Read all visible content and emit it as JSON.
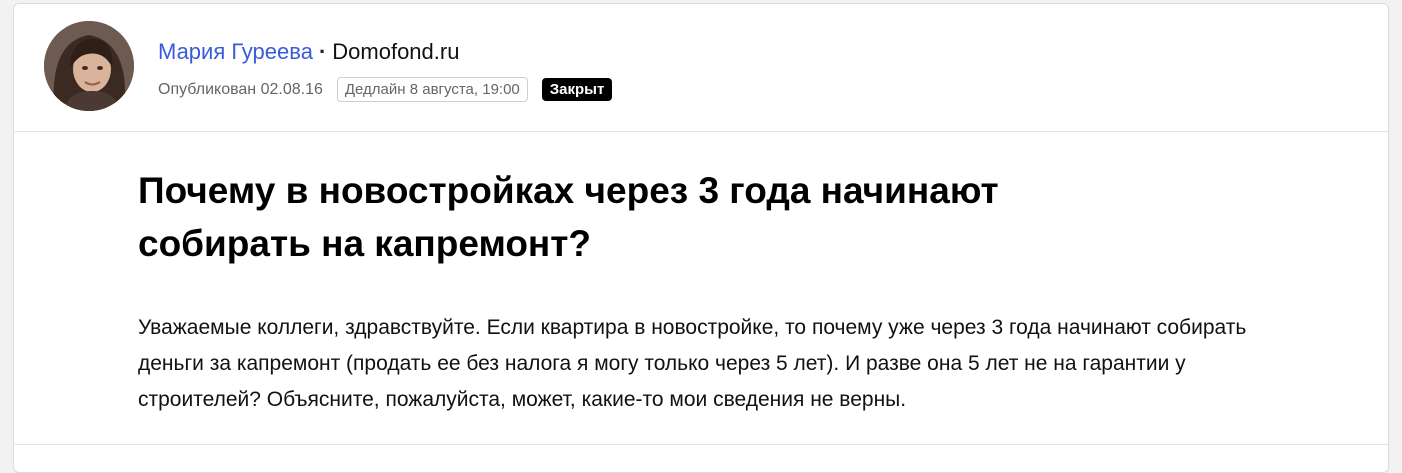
{
  "author": {
    "name": "Мария Гуреева",
    "company": "Domofond.ru",
    "separator": "·",
    "avatar_icon": "author-photo"
  },
  "meta": {
    "published": "Опубликован 02.08.16",
    "deadline": "Дедлайн 8 августа, 19:00",
    "status": "Закрыт"
  },
  "question": {
    "title": "Почему в новостройках через 3 года начинают собирать на капремонт?",
    "body": "Уважаемые коллеги, здравствуйте. Если квартира в новостройке, то почему уже через 3 года начинают собирать деньги за капремонт (продать ее без налога я могу только через 5 лет). И разве она 5 лет не на гарантии у строителей? Объясните, пожалуйста, может, какие-то мои сведения не верны."
  },
  "colors": {
    "author_link": "#3a5bd9",
    "status_bg": "#000000",
    "status_text": "#ffffff"
  }
}
